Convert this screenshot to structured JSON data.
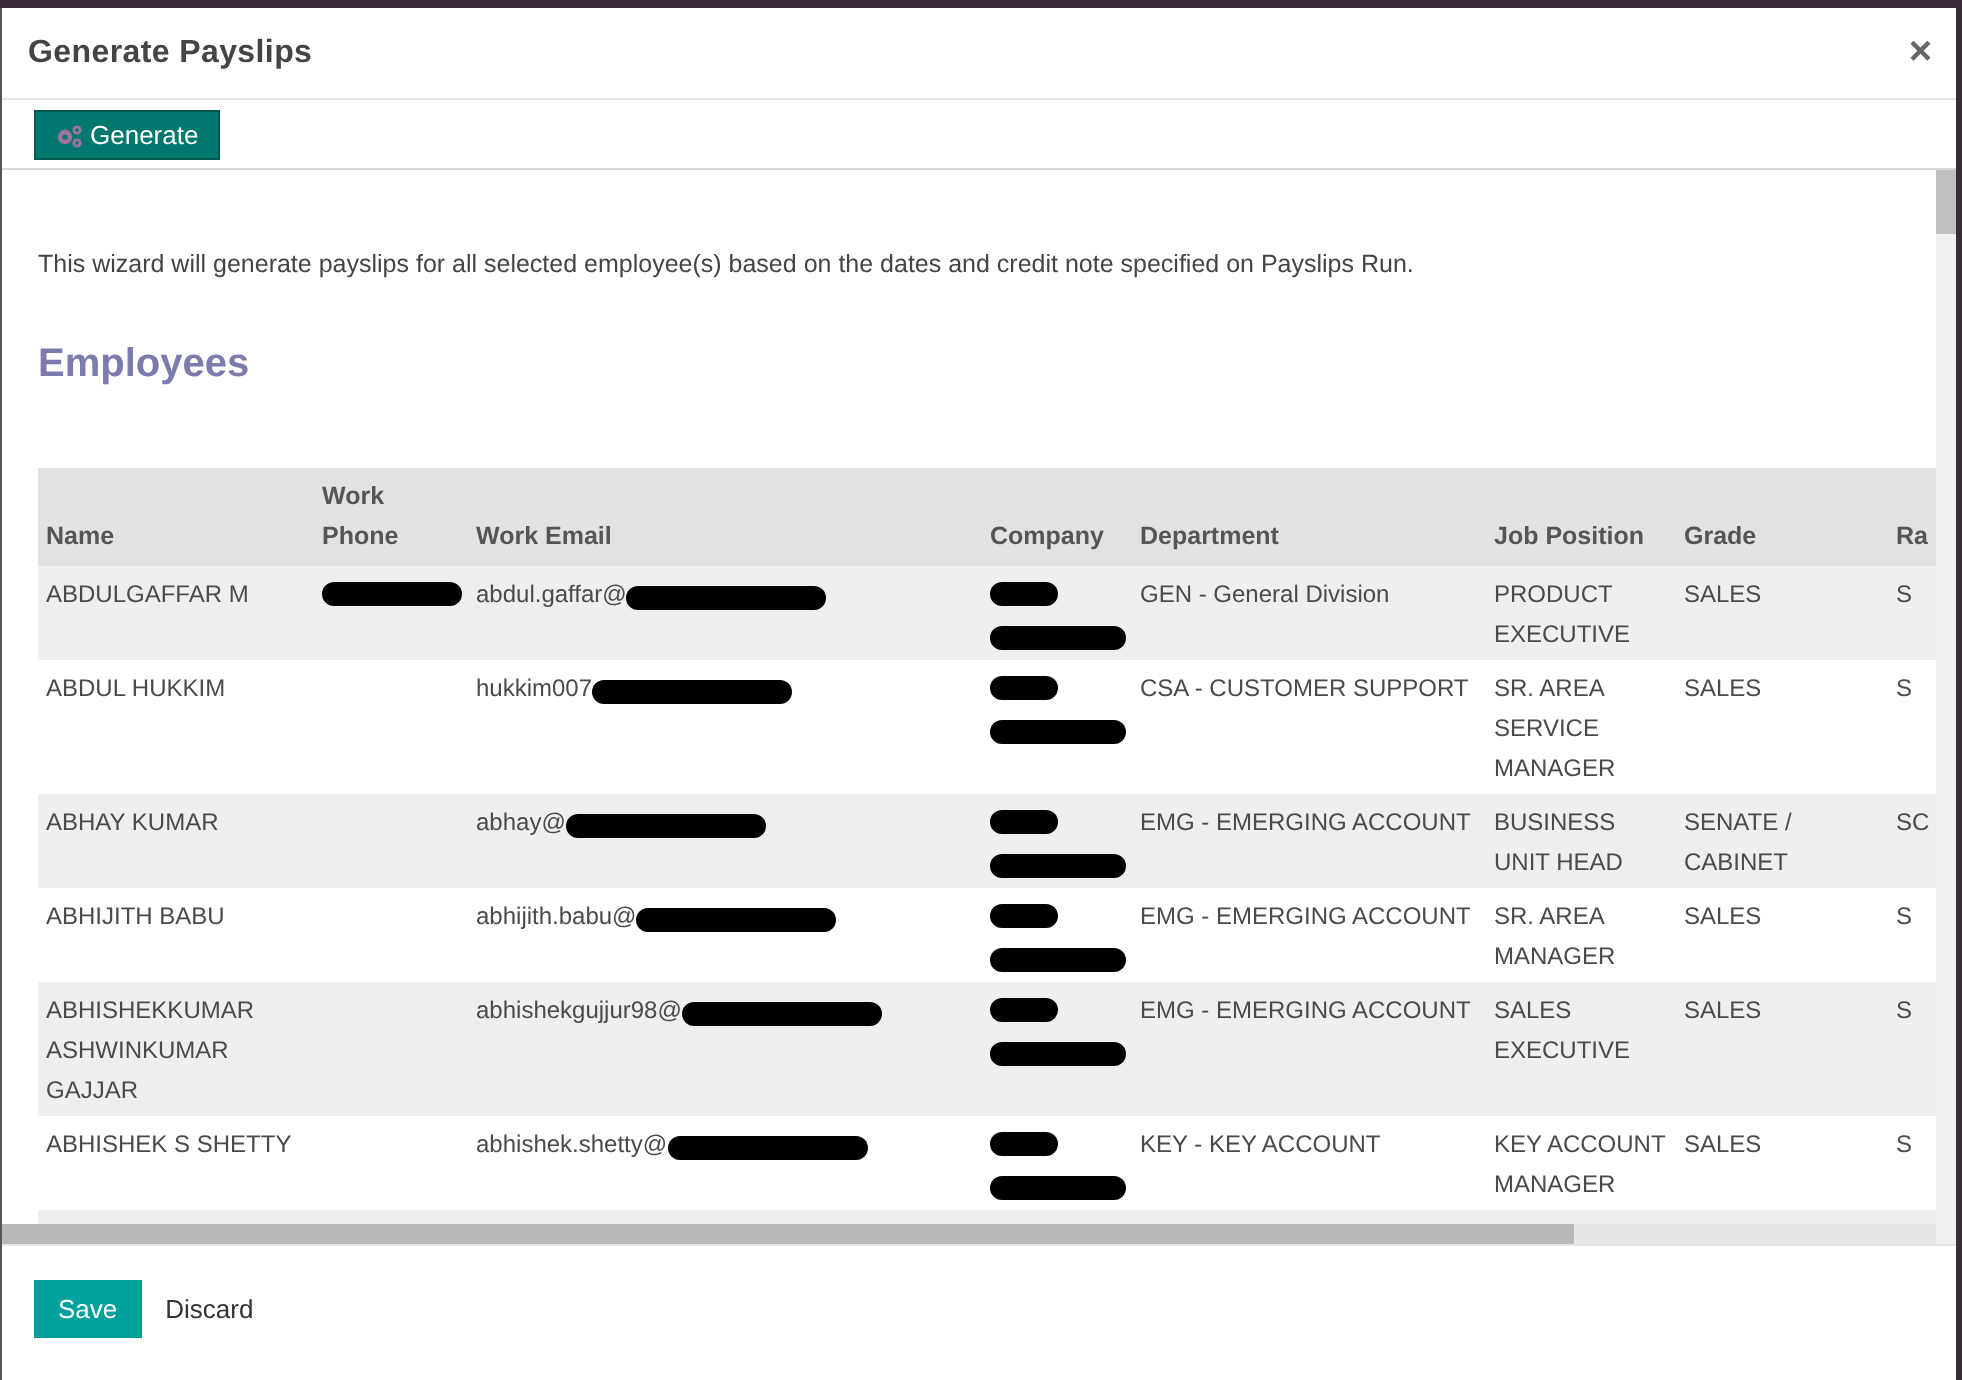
{
  "dialog": {
    "title": "Generate Payslips",
    "close": "×"
  },
  "toolbar": {
    "generate_button": "Generate"
  },
  "description": "This wizard will generate payslips for all selected employee(s) based on the dates and credit note specified on Payslips Run.",
  "section_title": "Employees",
  "table": {
    "columns": [
      "Name",
      "Work Phone",
      "Work Email",
      "Company",
      "Department",
      "Job Position",
      "Grade",
      "Ra"
    ],
    "rows": [
      {
        "name": "ABDULGAFFAR M",
        "phone_redacted": true,
        "email": "abdul.gaffar@",
        "company_redacted": true,
        "department": "GEN - General Division",
        "job_position": "PRODUCT EXECUTIVE",
        "grade": "SALES",
        "column_8": "S"
      },
      {
        "name": "ABDUL HUKKIM",
        "phone_redacted": false,
        "email": "hukkim007",
        "company_redacted": true,
        "department": "CSA - CUSTOMER SUPPORT",
        "job_position": "SR. AREA SERVICE MANAGER",
        "grade": "SALES",
        "column_8": "S"
      },
      {
        "name": "ABHAY KUMAR",
        "phone_redacted": false,
        "email": "abhay@",
        "company_redacted": true,
        "department": "EMG - EMERGING ACCOUNT",
        "job_position": "BUSINESS UNIT HEAD",
        "grade": "SENATE / CABINET",
        "column_8": "SC"
      },
      {
        "name": "ABHIJITH BABU",
        "phone_redacted": false,
        "email": "abhijith.babu@",
        "company_redacted": true,
        "department": "EMG - EMERGING ACCOUNT",
        "job_position": "SR. AREA MANAGER",
        "grade": "SALES",
        "column_8": "S"
      },
      {
        "name": "ABHISHEKKUMAR ASHWINKUMAR GAJJAR",
        "phone_redacted": false,
        "email": "abhishekgujjur98@",
        "company_redacted": true,
        "department": "EMG - EMERGING ACCOUNT",
        "job_position": "SALES EXECUTIVE",
        "grade": "SALES",
        "column_8": "S"
      },
      {
        "name": "ABHISHEK S SHETTY",
        "phone_redacted": false,
        "email": "abhishek.shetty@",
        "company_redacted": true,
        "department": "KEY - KEY ACCOUNT",
        "job_position": "KEY ACCOUNT MANAGER",
        "grade": "SALES",
        "column_8": "S"
      }
    ]
  },
  "footer": {
    "buttons": [
      {
        "label": "Save",
        "kind": "primary"
      },
      {
        "label": "Discard",
        "kind": "link"
      }
    ]
  }
}
